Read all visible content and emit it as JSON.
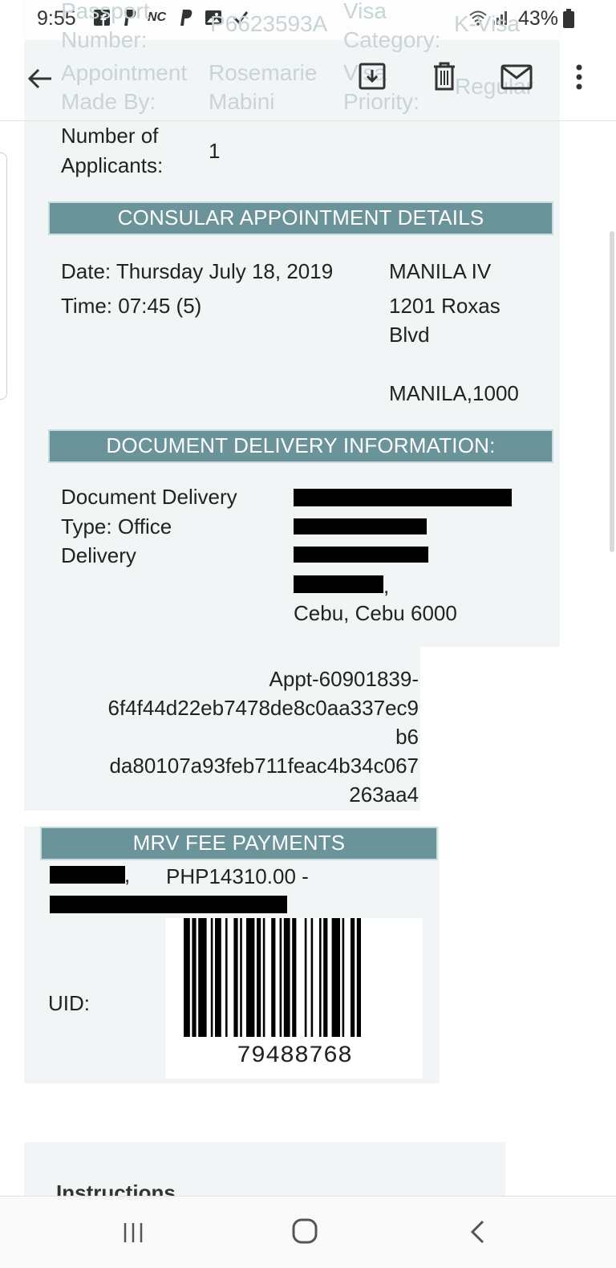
{
  "status_bar": {
    "time": "9:55",
    "notif_icons": [
      "facebook-icon",
      "paypal-icon",
      "nc-icon",
      "paypal-icon",
      "image-icon",
      "check-icon"
    ],
    "nc_label": "NC",
    "battery": "43%"
  },
  "header_faded": {
    "passport_label": "Passport Number:",
    "passport_value": "P6623593A",
    "visa_label": "Visa Category:",
    "visa_value": "K-Visa",
    "made_by_label": "Appointment Made By:",
    "made_by_value": "Rosemarie Mabini",
    "priority_label": "Visa Priority:",
    "priority_value": "Regular"
  },
  "applicants": {
    "label_line1": "Number of",
    "label_line2": "Applicants:",
    "value": "1"
  },
  "appointment": {
    "header": "CONSULAR APPOINTMENT DETAILS",
    "date": "Date:  Thursday July 18, 2019",
    "time": "Time: 07:45 (5)",
    "location_line1": "MANILA IV",
    "location_line2": "1201 Roxas",
    "location_line3": "Blvd",
    "location_line4": "MANILA,1000"
  },
  "delivery": {
    "header": "DOCUMENT DELIVERY INFORMATION:",
    "type_line1": "Document Delivery",
    "type_line2": "Type:  Office",
    "type_line3": "Delivery",
    "address_comma": ",",
    "address_city": "Cebu, Cebu 6000"
  },
  "appt_code": {
    "line1": "Appt-60901839-",
    "line2": "6f4f44d22eb7478de8c0aa337ec9",
    "line3": "b6",
    "line4": "da80107a93feb711feac4b34c067",
    "line5": "263aa4"
  },
  "mrv": {
    "header": "MRV FEE PAYMENTS",
    "comma": ",",
    "amount": "PHP14310.00 -",
    "uid_label": "UID:",
    "barcode_number": "79488768"
  },
  "instructions": {
    "title": "Instructions"
  },
  "colors": {
    "header_bg": "#6a939a",
    "panel_bg": "#f1f5f6"
  }
}
